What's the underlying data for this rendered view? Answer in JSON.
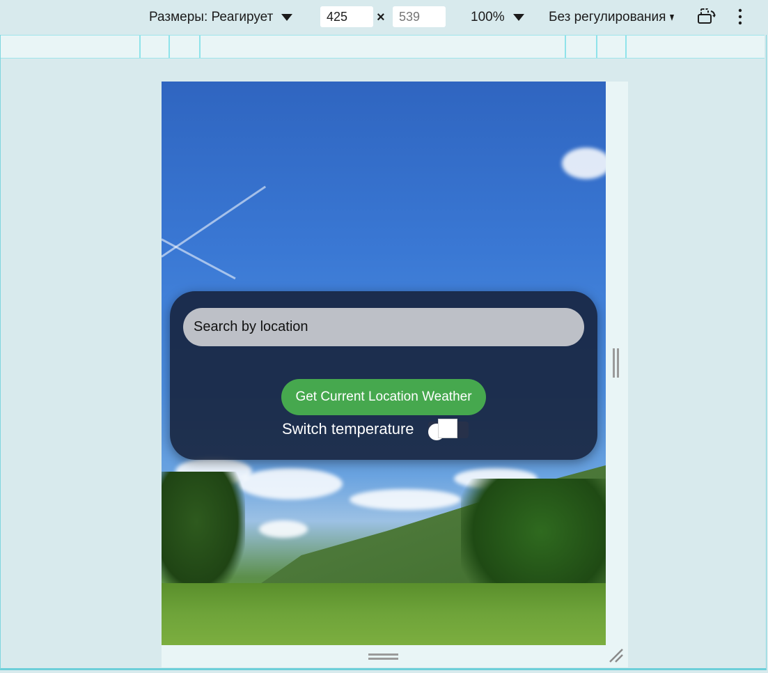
{
  "toolbar": {
    "dimensions_label": "Размеры: Реагирует",
    "width_value": "425",
    "height_placeholder": "539",
    "times": "×",
    "zoom_label": "100%",
    "throttle_label": "Без регулирования",
    "icons": {
      "dimensions_dropdown": "caret-down-icon",
      "zoom_dropdown": "caret-down-icon",
      "rotate": "rotate-device-icon",
      "more": "more-vertical-icon"
    }
  },
  "app": {
    "search_placeholder": "Search by location",
    "geo_button_label": "Get Current Location Weather",
    "switch_label": "Switch temperature",
    "colors": {
      "card_bg": "#16213a",
      "button_green": "#46a84e",
      "search_bg": "#bdc0c7"
    }
  },
  "handles": {
    "side": "resize-handle-icon",
    "bottom": "resize-handle-icon",
    "corner": "resize-corner-icon"
  }
}
